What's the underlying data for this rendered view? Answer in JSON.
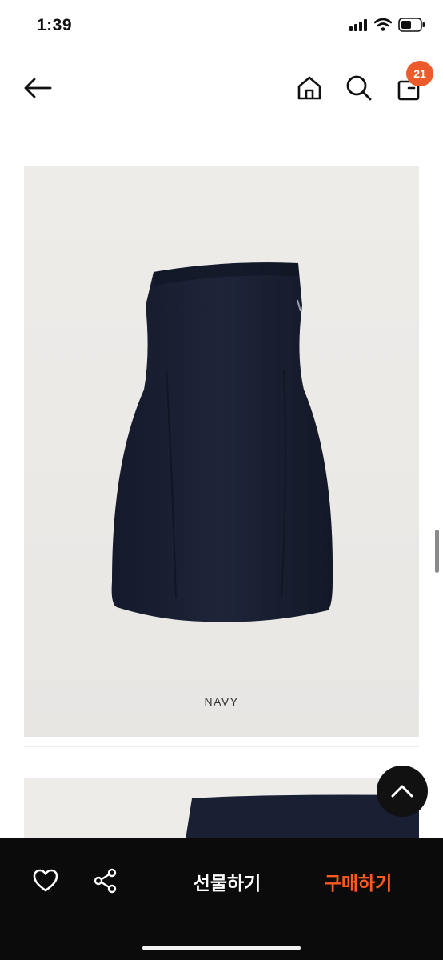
{
  "status": {
    "time": "1:39"
  },
  "nav": {
    "cart_count": "21"
  },
  "product": {
    "color_label": "NAVY"
  },
  "actions": {
    "gift_label": "선물하기",
    "buy_label": "구매하기"
  },
  "colors": {
    "accent": "#ec5b2b",
    "buy_text": "#ff5a1f",
    "dress": "#1a2033",
    "bar_bg": "#0b0b0b"
  },
  "icons": [
    "back-arrow-icon",
    "home-icon",
    "search-icon",
    "shopping-bag-icon",
    "chevron-up-icon",
    "heart-icon",
    "share-icon",
    "signal-icon",
    "wifi-icon",
    "battery-icon"
  ]
}
